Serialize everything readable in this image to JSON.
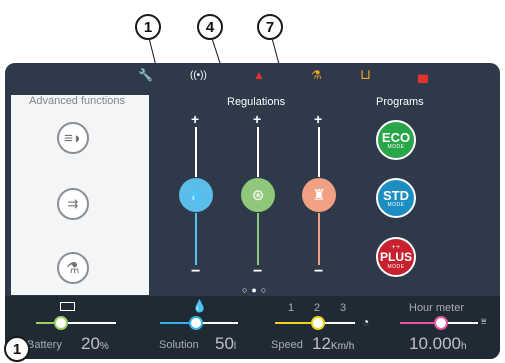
{
  "callouts": {
    "top": [
      "1",
      "4",
      "7"
    ],
    "bottom": "1"
  },
  "status_icons": [
    "wrench-icon",
    "wireless-signal-icon",
    "warning-triangle-icon",
    "flask-icon",
    "tank-icon",
    "tank-full-icon"
  ],
  "left_panel": {
    "title": "Advanced functions",
    "buttons": [
      "headlight-icon",
      "side-brush-icon",
      "flask-icon"
    ]
  },
  "regulations": {
    "title": "Regulations",
    "sliders": [
      {
        "name": "solution",
        "plus": "+",
        "minus": "−",
        "color": "#5bbde9",
        "level": 0.5
      },
      {
        "name": "brush",
        "plus": "+",
        "minus": "−",
        "color": "#8fc87a",
        "level": 0.5
      },
      {
        "name": "vacuum",
        "plus": "+",
        "minus": "−",
        "color": "#f2a084",
        "level": 0.5
      }
    ],
    "page_dots": "○●○"
  },
  "programs": {
    "title": "Programs",
    "items": [
      {
        "label": "ECO",
        "sub": "MODE",
        "color": "#2aa64a"
      },
      {
        "label": "STD",
        "sub": "MODE",
        "color": "#1c8ec2"
      },
      {
        "label": "PLUS",
        "sub": "MODE",
        "color": "#c8202f",
        "prefix": "++"
      }
    ]
  },
  "bottom_bar": {
    "battery": {
      "label": "Battery",
      "value": "20",
      "unit": "%",
      "color": "#9bd161",
      "level": 0.2
    },
    "solution": {
      "label": "Solution",
      "value": "50",
      "unit": "l",
      "color": "#39b1e6"
    },
    "speed": {
      "label": "Speed",
      "value": "12",
      "unit": "Km/h",
      "levels": [
        "1",
        "2",
        "3"
      ],
      "color": "#f2d220",
      "selected_level": "2"
    },
    "hour_meter": {
      "label": "Hour meter",
      "value": "10.000",
      "unit": "h",
      "color": "#e8559c"
    }
  },
  "colors": {
    "accent_orange": "#f4a31c",
    "alert_red": "#e2322c"
  }
}
